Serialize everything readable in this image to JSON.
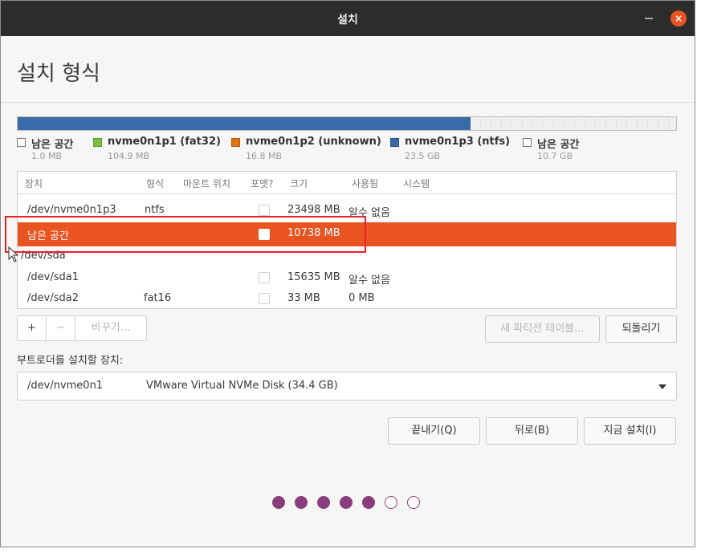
{
  "window": {
    "title": "설치",
    "close_glyph": "×"
  },
  "page_title": "설치 형식",
  "disk_bar": {
    "colors": {
      "p3": "#3b6aa8",
      "free": "#e8e8e8"
    }
  },
  "legend": [
    {
      "name": "남은 공간",
      "size": "1.0 MB",
      "color": "#ffffff"
    },
    {
      "name": "nvme0n1p1 (fat32)",
      "size": "104.9 MB",
      "color": "#7bc043"
    },
    {
      "name": "nvme0n1p2 (unknown)",
      "size": "16.8 MB",
      "color": "#e8720c"
    },
    {
      "name": "nvme0n1p3 (ntfs)",
      "size": "23.5 GB",
      "color": "#3b6aa8"
    },
    {
      "name": "남은 공간",
      "size": "10.7 GB",
      "color": "#ffffff"
    }
  ],
  "table": {
    "headers": [
      "장치",
      "형식",
      "마운트 위치",
      "포맷?",
      "크기",
      "사용됨",
      "시스템"
    ],
    "rows": [
      {
        "device": "/dev/nvme0n1p3",
        "type": "ntfs",
        "mount": "",
        "size": "23498 MB",
        "used": "알수 없음",
        "system": ""
      },
      {
        "device": "남은 공간",
        "type": "",
        "mount": "",
        "size": "10738 MB",
        "used": "",
        "system": ""
      },
      {
        "device": "/dev/sda",
        "type": "",
        "mount": "",
        "size": "",
        "used": "",
        "system": ""
      },
      {
        "device": "/dev/sda1",
        "type": "",
        "mount": "",
        "size": "15635 MB",
        "used": "알수 없음",
        "system": ""
      },
      {
        "device": "/dev/sda2",
        "type": "fat16",
        "mount": "",
        "size": "33 MB",
        "used": "0 MB",
        "system": ""
      }
    ]
  },
  "toolbar": {
    "add": "+",
    "remove": "−",
    "change": "바꾸기...",
    "new_table": "새 파티션 테이블...",
    "revert": "되돌리기"
  },
  "bootloader": {
    "label": "부트로더를 설치할 장치:",
    "device": "/dev/nvme0n1",
    "description": "VMware Virtual NVMe Disk (34.4 GB)"
  },
  "actions": {
    "quit": "끝내기(Q)",
    "back": "뒤로(B)",
    "install": "지금 설치(I)"
  },
  "progress": {
    "total": 7,
    "completed": 5,
    "color": "#8a3d7d"
  }
}
